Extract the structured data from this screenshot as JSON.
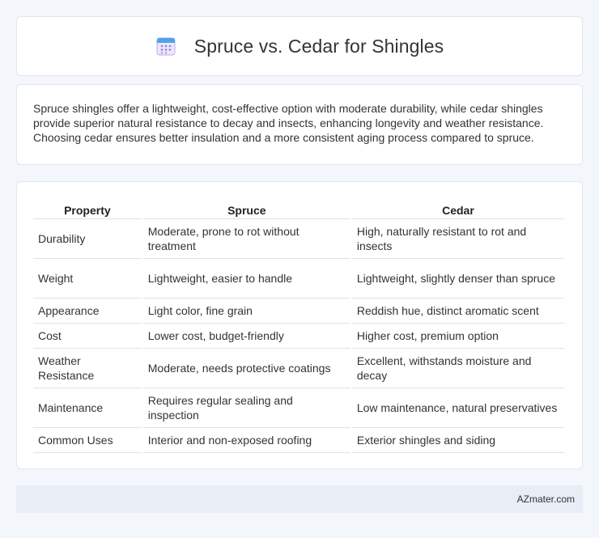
{
  "header": {
    "title": "Spruce vs. Cedar for Shingles",
    "icon": "calendar-icon",
    "icon_color": "#8a7bd8"
  },
  "summary": {
    "text": "Spruce shingles offer a lightweight, cost-effective option with moderate durability, while cedar shingles provide superior natural resistance to decay and insects, enhancing longevity and weather resistance. Choosing cedar ensures better insulation and a more consistent aging process compared to spruce."
  },
  "table": {
    "headers": [
      "Property",
      "Spruce",
      "Cedar"
    ],
    "rows": [
      [
        "Durability",
        "Moderate, prone to rot without treatment",
        "High, naturally resistant to rot and insects"
      ],
      [
        "Weight",
        "Lightweight, easier to handle",
        "Lightweight, slightly denser than spruce"
      ],
      [
        "Appearance",
        "Light color, fine grain",
        "Reddish hue, distinct aromatic scent"
      ],
      [
        "Cost",
        "Lower cost, budget-friendly",
        "Higher cost, premium option"
      ],
      [
        "Weather Resistance",
        "Moderate, needs protective coatings",
        "Excellent, withstands moisture and decay"
      ],
      [
        "Maintenance",
        "Requires regular sealing and inspection",
        "Low maintenance, natural preservatives"
      ],
      [
        "Common Uses",
        "Interior and non-exposed roofing",
        "Exterior shingles and siding"
      ]
    ]
  },
  "footer": {
    "text": "AZmater.com"
  }
}
